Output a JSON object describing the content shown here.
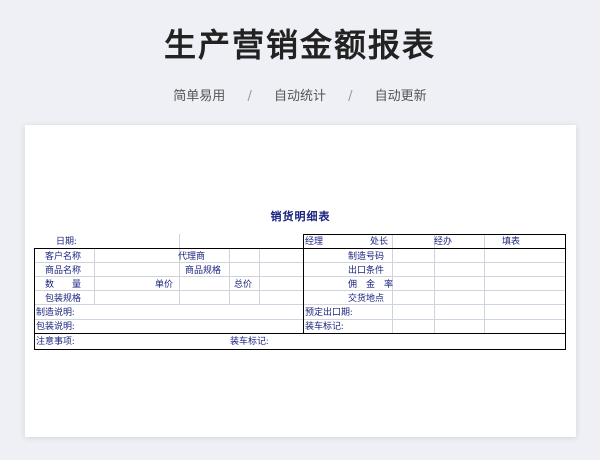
{
  "header": {
    "title": "生产营销金额报表",
    "tags": [
      "简单易用",
      "自动统计",
      "自动更新"
    ],
    "separator": "/"
  },
  "document": {
    "title": "销货明细表",
    "date_label": "日期:",
    "approvals": [
      "经理",
      "处长",
      "经办",
      "填表"
    ],
    "rows": {
      "customer": "客户名称",
      "agent": "代理商",
      "product_no": "制造号码",
      "product_name": "商品名称",
      "product_spec": "商品规格",
      "export_terms": "出口条件",
      "qty": "数　　量",
      "unit_price": "单价",
      "total_price": "总价",
      "commission": "佣　金　率",
      "packaging_spec": "包装规格",
      "delivery_place": "交货地点",
      "mfg_note": "制造说明:",
      "planned_export": "预定出口期:",
      "packaging_note": "包装说明:",
      "loading_mark": "装车标记:",
      "notes": "注意事项:",
      "loading_mark2": "装车标记:"
    }
  }
}
